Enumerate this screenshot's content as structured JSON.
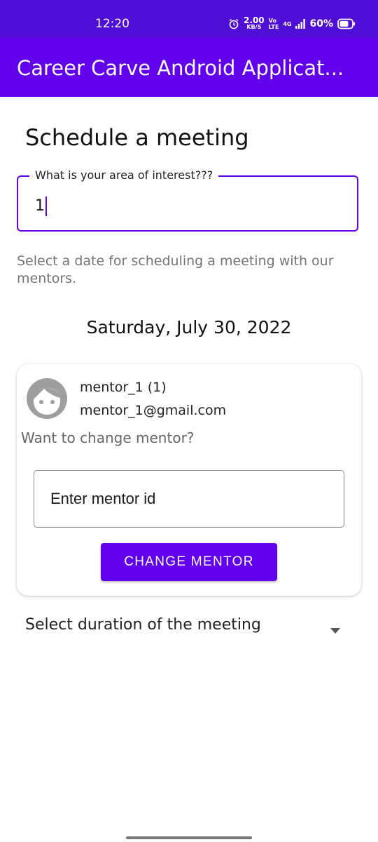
{
  "status_bar": {
    "time": "12:20",
    "network_speed_value": "2.00",
    "network_speed_unit": "KB/S",
    "volte_top": "Vo",
    "volte_bottom": "LTE",
    "network_type": "4G",
    "battery_percent": "60%",
    "icons": [
      "alarm-icon",
      "signal-icon",
      "battery-icon"
    ]
  },
  "app_bar": {
    "title": "Career Carve Android Applicat..."
  },
  "main": {
    "heading": "Schedule a meeting",
    "interest_field": {
      "label": "What is your area of interest???",
      "value": "1"
    },
    "helper_text": "Select a date for scheduling a meeting with our mentors.",
    "selected_date": "Saturday, July 30, 2022",
    "mentor_card": {
      "avatar_icon": "face-icon",
      "mentor_name": "mentor_1 (1)",
      "mentor_email": "mentor_1@gmail.com",
      "change_prompt": "Want to change mentor?",
      "mentor_id_placeholder": "Enter mentor id",
      "change_button_label": "CHANGE MENTOR"
    },
    "duration_select": {
      "label": "Select duration of the meeting",
      "icon": "dropdown-arrow-icon"
    }
  },
  "colors": {
    "status_bar": "#4f0fd6",
    "primary": "#6200ee",
    "secondary_text": "#757575"
  }
}
